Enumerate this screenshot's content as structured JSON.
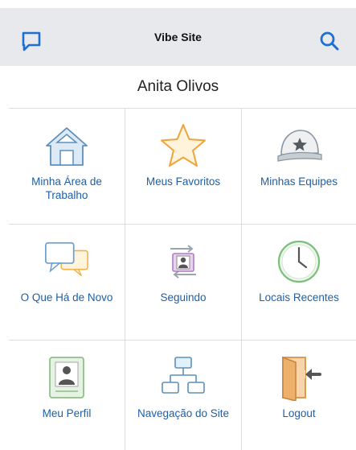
{
  "header": {
    "title": "Vibe Site",
    "left_icon": "chat-bubble-icon",
    "right_icon": "search-icon",
    "background": "#e7e9ec",
    "accent": "#1e6fd1"
  },
  "user": {
    "name": "Anita Olivos"
  },
  "tiles": [
    {
      "label": "Minha Área de Trabalho",
      "icon": "home-icon"
    },
    {
      "label": "Meus Favoritos",
      "icon": "star-icon"
    },
    {
      "label": "Minhas Equipes",
      "icon": "team-cap-icon"
    },
    {
      "label": "O Que Há de Novo",
      "icon": "speech-bubbles-icon"
    },
    {
      "label": "Seguindo",
      "icon": "following-icon"
    },
    {
      "label": "Locais Recentes",
      "icon": "clock-icon"
    },
    {
      "label": "Meu Perfil",
      "icon": "profile-card-icon"
    },
    {
      "label": "Navegação do Site",
      "icon": "sitemap-icon"
    },
    {
      "label": "Logout",
      "icon": "logout-door-icon"
    }
  ],
  "colors": {
    "label": "#1d5fa8",
    "divider": "#dcdcdc"
  }
}
